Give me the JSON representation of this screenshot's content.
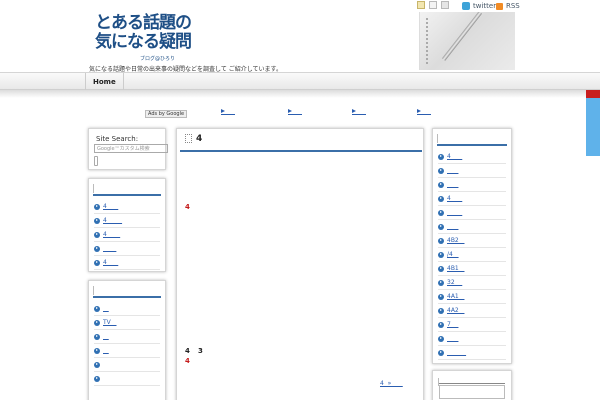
{
  "topbar": {
    "twitter_label": "twitter",
    "rss_label": "RSS"
  },
  "header": {
    "logo_line1": "とある話題の",
    "logo_line2": "気になる疑問",
    "logo_sub": "ブログ@ひろり",
    "tagline": "気になる話題や日常の出来事の疑問などを調査して ご紹介しています。"
  },
  "nav": {
    "home_label": "Home"
  },
  "ads": {
    "badge": "Ads by Google"
  },
  "search": {
    "label": "Site Search:",
    "placeholder": "Google™カスタム検索"
  },
  "left_panel_1": {
    "items": [
      "4      ",
      "4        ",
      "4       ",
      "       ",
      "4      "
    ]
  },
  "left_panel_2": {
    "items": [
      "   ",
      "TV   ",
      "   ",
      "   ",
      "",
      ""
    ]
  },
  "main": {
    "title": "4",
    "red_a": "4",
    "black_a": "4",
    "black_b": "3",
    "red_b": "4",
    "more_link": "4  »      "
  },
  "right_panel": {
    "items": [
      "4      ",
      "      ",
      "      ",
      "4      ",
      "        ",
      "      ",
      "4B2   ",
      "/4   ",
      "4B1   ",
      "32    ",
      "4A1   ",
      "4A2   ",
      "7    ",
      "      ",
      "          "
    ]
  },
  "colors": {
    "accent": "#3b6fa8",
    "link": "#2a5db0",
    "brand": "#1e4f86",
    "alert": "#c41a1a"
  }
}
